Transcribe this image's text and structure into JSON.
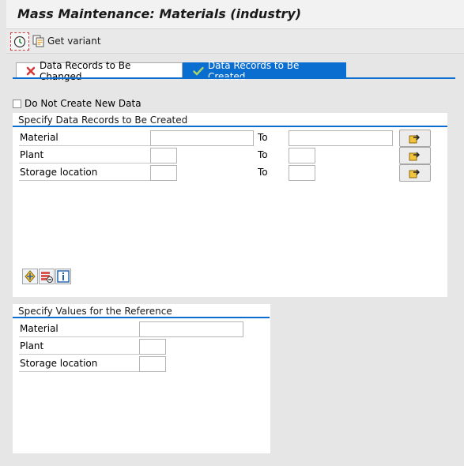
{
  "window": {
    "title": "Mass Maintenance: Materials (industry)"
  },
  "toolbar": {
    "execute_icon": "clock-execute-icon",
    "get_variant_label": "Get variant"
  },
  "tabs": [
    {
      "label": "Data Records to Be Changed",
      "icon": "red-x-icon",
      "active": false
    },
    {
      "label": "Data Records to Be Created",
      "icon": "green-check-icon",
      "active": true
    }
  ],
  "options": {
    "do_not_create_label": "Do Not Create New Data",
    "do_not_create_checked": false
  },
  "create_section": {
    "title": "Specify Data Records to Be Created",
    "to_label": "To",
    "rows": [
      {
        "label": "Material",
        "from": "",
        "to": ""
      },
      {
        "label": "Plant",
        "from": "",
        "to": ""
      },
      {
        "label": "Storage location",
        "from": "",
        "to": ""
      }
    ],
    "button_icons": [
      "add-fields-icon",
      "remove-fields-icon",
      "info-icon"
    ]
  },
  "reference_section": {
    "title": "Specify Values for the Reference",
    "rows": [
      {
        "label": "Material",
        "value": ""
      },
      {
        "label": "Plant",
        "value": ""
      },
      {
        "label": "Storage location",
        "value": ""
      }
    ]
  },
  "colors": {
    "accent": "#0a6ed1",
    "background": "#e6e6e6"
  }
}
